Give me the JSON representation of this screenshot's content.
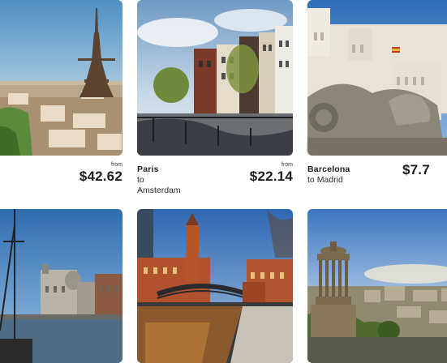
{
  "cards": [
    {
      "image_alt": "Eiffel Tower over Paris",
      "from_city": "",
      "to_prefix": "",
      "to_city": "",
      "from_label": "from",
      "price": "$42.62"
    },
    {
      "image_alt": "Amsterdam canal houses",
      "from_city": "Paris",
      "to_prefix": "to",
      "to_city": "Amsterdam",
      "from_label": "from",
      "price": "$22.14"
    },
    {
      "image_alt": "Cibeles Palace, Madrid",
      "from_city": "Barcelona",
      "to_prefix": "to",
      "to_city": "Madrid",
      "from_label": "",
      "price": "$7.7"
    },
    {
      "image_alt": "Liverpool waterfront"
    },
    {
      "image_alt": "Manchester canal with brick bridge"
    },
    {
      "image_alt": "Edinburgh Dugald Stewart Monument"
    }
  ]
}
